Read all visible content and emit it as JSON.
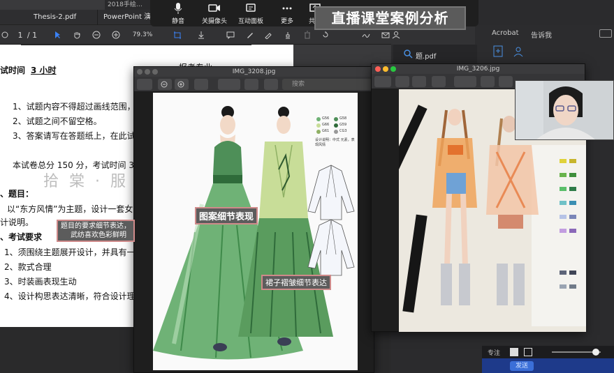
{
  "pdf_window": {
    "top_small_tab": "2018手绘…",
    "tabs": [
      "Thesis-2.pdf",
      "PowerPoint 演示..."
    ],
    "toolbar": {
      "page_current": "1",
      "page_total": "/ 1",
      "zoom": "79.3%"
    },
    "side_label": "题.pdf",
    "document": {
      "header_left": "试时间",
      "header_underlined": "3 小时",
      "header_right": "报考专业",
      "rules": [
        "1、试题内容不得超过画线范围，试题",
        "2、试题之间不留空格。",
        "3、答案请写在答题纸上，在此试卷上"
      ],
      "total_line": "本试卷总分 150 分，考试时间 3 小时",
      "section1": "、题目：",
      "section1_body": "以“东方风情”为主题，设计一套女式",
      "section1_tail": "计说明。",
      "section2": "、考试要求",
      "requirements": [
        "1、须围绕主题展开设计，并具有一定年",
        "2、款式合理",
        "3、时装画表现生动",
        "4、设计构思表达清晰，符合设计理念"
      ],
      "watermark": "拾 棠 · 服"
    }
  },
  "zoom_meeting_bar": {
    "items": [
      {
        "label": "静音",
        "icon": "microphone-icon"
      },
      {
        "label": "关摄像头",
        "icon": "video-camera-icon"
      },
      {
        "label": "互动面板",
        "icon": "chat-panel-icon"
      },
      {
        "label": "更多",
        "icon": "more-dots-icon"
      },
      {
        "label": "共享",
        "icon": "share-screen-icon"
      }
    ]
  },
  "banner_title": "直播课堂案例分析",
  "acrobat": {
    "label": "Acrobat",
    "tell_me": "告诉我"
  },
  "image_window_1": {
    "title": "IMG_3208.jpg",
    "search_placeholder": "搜索",
    "swatch_notes": [
      "G56",
      "G58",
      "G66",
      "G59",
      "G61",
      "CG3"
    ],
    "palette_note": "设计说明：中式 元素，表现风情",
    "callout_pattern": "图案细节表现",
    "callout_skirt": "裙子褶皱细节表达"
  },
  "image_window_2": {
    "title": "IMG_3206.jpg"
  },
  "left_callout": {
    "line1": "题目的要求细节表达，",
    "line2": "武纺喜欢色彩鲜明"
  },
  "bottom_right": {
    "focus_label": "专注",
    "send_label": "发送"
  },
  "colors": {
    "banner_bg": "#5b5b5b",
    "callout_border": "#cf8a8a",
    "dress_green": "#4f9a5c",
    "mac_red": "#ff5f57",
    "mac_yellow": "#febc2e",
    "mac_green": "#28c840"
  }
}
